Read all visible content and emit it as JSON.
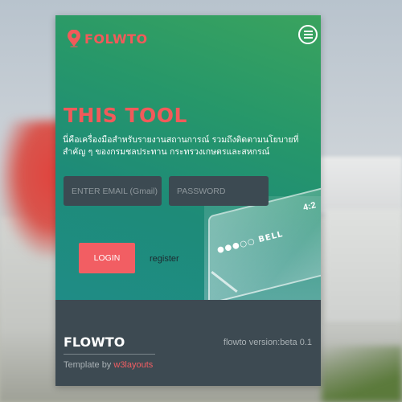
{
  "header": {
    "logo_text": "FOLWTO",
    "logo_icon": "map-pin-icon",
    "menu_icon": "menu-icon"
  },
  "hero": {
    "title": "THIS TOOL",
    "description": "นี่คือเครื่องมือสำหรับรายงานสถานการณ์ รวมถึงติดตามนโยบายที่สำคัญ ๆ ของกรมชลประทาน กระทรวงเกษตรและสหกรณ์",
    "phone_carrier": "●●●○○ BELL",
    "phone_time": "4:2"
  },
  "form": {
    "email_placeholder": "ENTER EMAIL (Gmail)",
    "password_placeholder": "PASSWORD",
    "login_label": "LOGIN",
    "register_label": "register"
  },
  "footer": {
    "brand": "FLOWTO",
    "version": "flowto version:beta 0.1",
    "credit_prefix": "Template by ",
    "credit_link": "w3layouts"
  },
  "colors": {
    "accent": "#f25e63",
    "hero_green": "#26976a",
    "footer_bg": "#3d4a52",
    "input_bg": "#3c4a52"
  }
}
